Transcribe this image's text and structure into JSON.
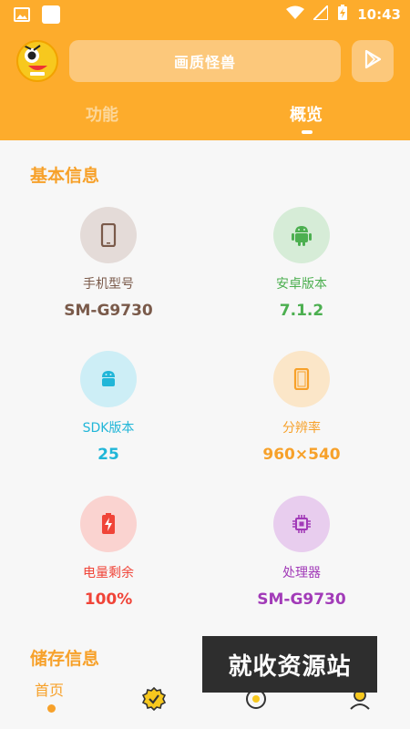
{
  "status_bar": {
    "time": "10:43"
  },
  "header": {
    "search_text": "画质怪兽",
    "tabs": [
      {
        "label": "功能",
        "active": false
      },
      {
        "label": "概览",
        "active": true
      }
    ]
  },
  "basic_info": {
    "title": "基本信息",
    "items": [
      {
        "label": "手机型号",
        "value": "SM-G9730",
        "icon": "phone-icon",
        "color": "#7a5a4a",
        "bg": "#e4dbd8"
      },
      {
        "label": "安卓版本",
        "value": "7.1.2",
        "icon": "android-icon",
        "color": "#4caf50",
        "bg": "#d6ecd7"
      },
      {
        "label": "SDK版本",
        "value": "25",
        "icon": "android-sdk-icon",
        "color": "#21b6d8",
        "bg": "#cdeef6"
      },
      {
        "label": "分辨率",
        "value": "960×540",
        "icon": "screen-icon",
        "color": "#f7a12a",
        "bg": "#fbe6c8"
      },
      {
        "label": "电量剩余",
        "value": "100%",
        "icon": "battery-charging-icon",
        "color": "#f04438",
        "bg": "#fad3d0"
      },
      {
        "label": "处理器",
        "value": "SM-G9730",
        "icon": "cpu-icon",
        "color": "#a23bb8",
        "bg": "#e8cdee"
      }
    ]
  },
  "storage_info": {
    "title": "储存信息"
  },
  "bottom_nav": {
    "home_label": "首页"
  },
  "watermark": {
    "text": "就收资源站"
  }
}
